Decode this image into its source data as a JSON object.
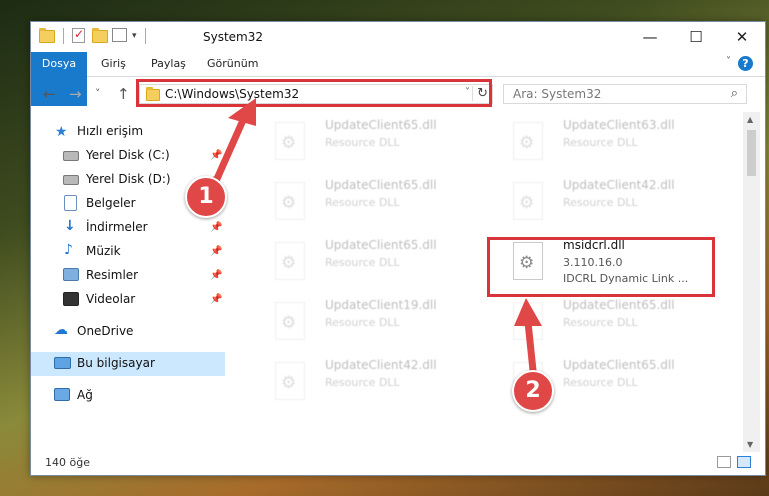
{
  "window": {
    "title": "System32",
    "minimize": "—",
    "maximize": "☐",
    "close": "✕"
  },
  "ribbon": {
    "tabs": [
      "Dosya",
      "Giriş",
      "Paylaş",
      "Görünüm"
    ],
    "help": "?"
  },
  "nav": {
    "back": "←",
    "forward": "→",
    "recent": "˅",
    "up": "↑",
    "address": "C:\\Windows\\System32",
    "search_placeholder": "Ara: System32"
  },
  "sidebar": {
    "items": [
      {
        "label": "Hızlı erişim",
        "icon": "star-icon",
        "pinned": false
      },
      {
        "label": "Yerel Disk (C:)",
        "icon": "drive-icon",
        "pinned": true
      },
      {
        "label": "Yerel Disk (D:)",
        "icon": "drive-icon",
        "pinned": true
      },
      {
        "label": "Belgeler",
        "icon": "documents-icon",
        "pinned": true
      },
      {
        "label": "İndirmeler",
        "icon": "download-icon",
        "pinned": true
      },
      {
        "label": "Müzik",
        "icon": "music-icon",
        "pinned": true
      },
      {
        "label": "Resimler",
        "icon": "pictures-icon",
        "pinned": true
      },
      {
        "label": "Videolar",
        "icon": "videos-icon",
        "pinned": true
      },
      {
        "label": "OneDrive",
        "icon": "cloud-icon",
        "pinned": false
      },
      {
        "label": "Bu bilgisayar",
        "icon": "computer-icon",
        "pinned": false
      },
      {
        "label": "Ağ",
        "icon": "network-icon",
        "pinned": false
      }
    ]
  },
  "files": [
    {
      "name": "UpdateClient65.dll",
      "type": "Resource DLL"
    },
    {
      "name": "UpdateClient63.dll",
      "type": "Resource DLL"
    },
    {
      "name": "UpdateClient65.dll",
      "type": "Resource DLL"
    },
    {
      "name": "UpdateClient42.dll",
      "type": "Resource DLL"
    },
    {
      "name": "UpdateClient65.dll",
      "type": "Resource DLL"
    },
    {
      "name": "msidcrl.dll",
      "version": "3.110.16.0",
      "type": "IDCRL Dynamic Link ..."
    },
    {
      "name": "UpdateClient19.dll",
      "type": "Resource DLL"
    },
    {
      "name": "UpdateClient65.dll",
      "type": "Resource DLL"
    },
    {
      "name": "UpdateClient42.dll",
      "type": "Resource DLL"
    },
    {
      "name": "UpdateClient65.dll",
      "type": "Resource DLL"
    }
  ],
  "status": {
    "count": "140 öğe"
  },
  "annotations": {
    "step1": "1",
    "step2": "2",
    "color": "#d9343a"
  }
}
